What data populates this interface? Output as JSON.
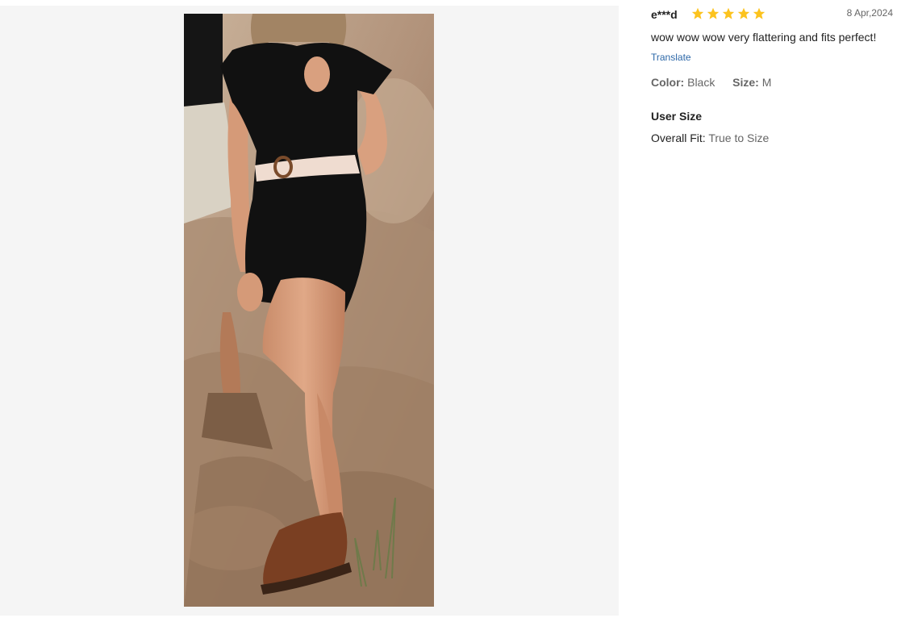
{
  "review": {
    "user": "e***d",
    "rating": 5,
    "star_color": "#fcc31e",
    "date": "8 Apr,2024",
    "text": "wow wow wow very flattering and fits perfect!",
    "translate_label": "Translate",
    "attributes": {
      "color_label": "Color:",
      "color_value": "Black",
      "size_label": "Size:",
      "size_value": "M"
    },
    "user_size": {
      "title": "User Size",
      "fit_label": "Overall Fit:",
      "fit_value": "True to Size"
    }
  },
  "photo": {
    "colors": {
      "panel_background": "#f5f5f5",
      "rock": "#b79c80",
      "dress": "#111111",
      "skin": "#d9a07f",
      "belt": "#efdcd0",
      "shoe": "#7a3f22"
    }
  }
}
